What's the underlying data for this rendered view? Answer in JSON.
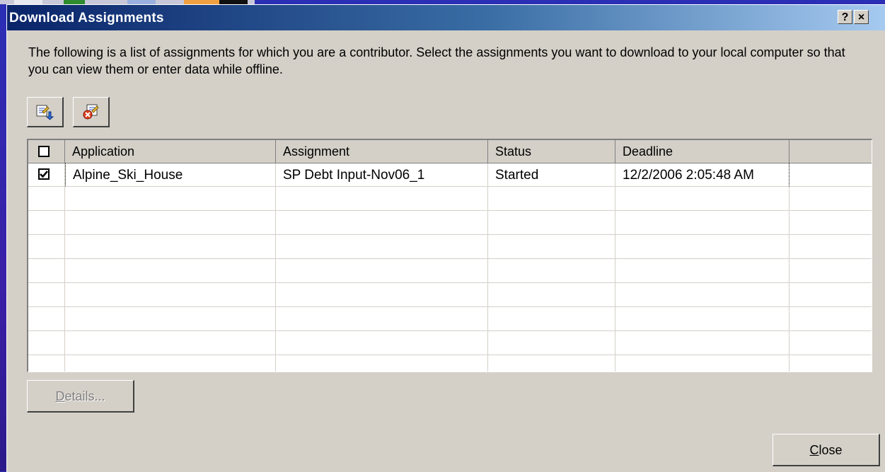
{
  "window": {
    "title": "Download Assignments",
    "help_label": "?",
    "close_label": "×"
  },
  "description": "The following is a list of assignments for which you are a contributor. Select the assignments you want to download to your local computer so that you can view them or enter data while offline.",
  "toolbar": {
    "download_icon": "download-assignment-icon",
    "remove_icon": "remove-assignment-icon"
  },
  "grid": {
    "columns": [
      "Application",
      "Assignment",
      "Status",
      "Deadline"
    ],
    "rows": [
      {
        "checked": true,
        "application": "Alpine_Ski_House",
        "assignment": "SP Debt Input-Nov06_1",
        "status": "Started",
        "deadline": "12/2/2006 2:05:48 AM"
      }
    ],
    "empty_row_count": 8
  },
  "buttons": {
    "details_prefix": "D",
    "details_rest": "etails...",
    "close_prefix": "C",
    "close_rest": "lose"
  },
  "colors": {
    "dialog_bg": "#d4d0c8",
    "title_start": "#0a246a",
    "title_end": "#a6caf0",
    "desktop": "#2a2fb5"
  }
}
